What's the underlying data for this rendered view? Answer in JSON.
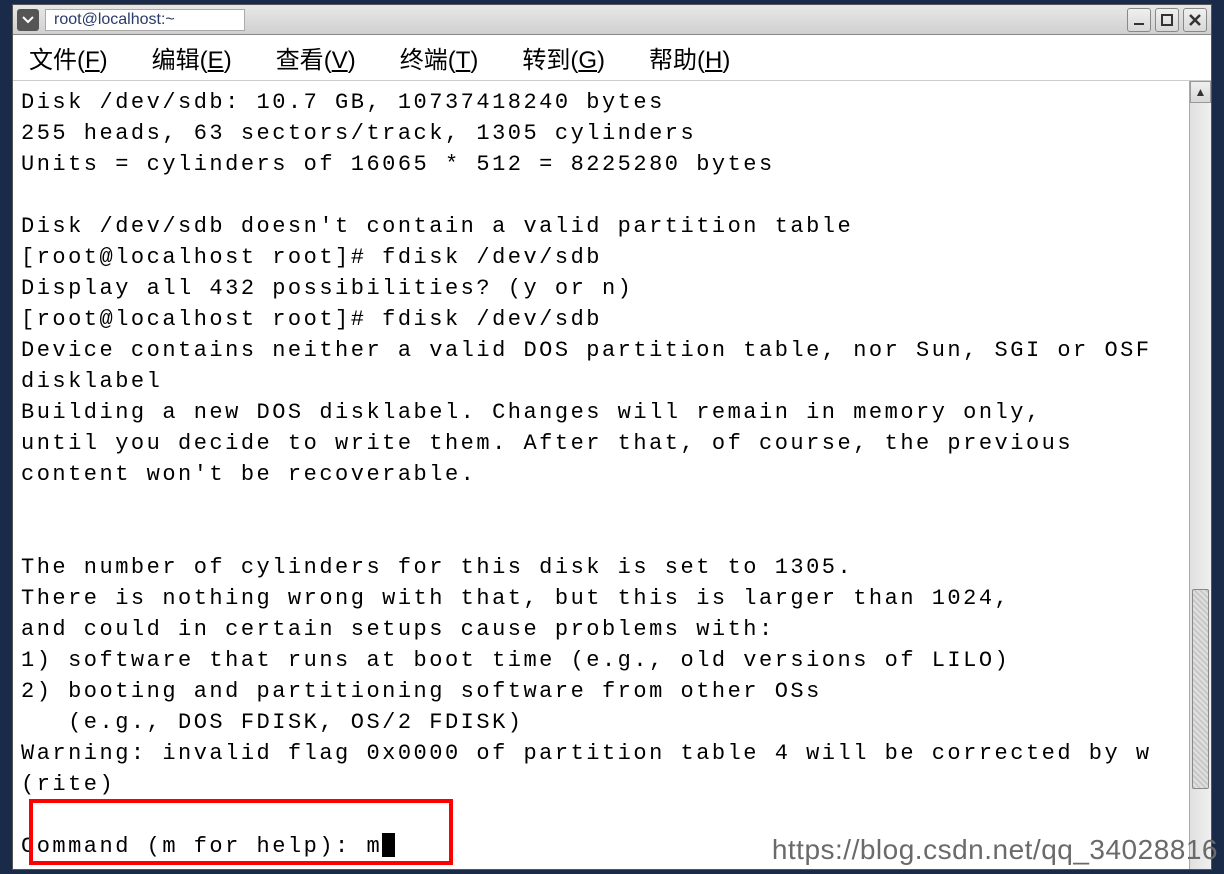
{
  "titlebar": {
    "title": "root@localhost:~"
  },
  "menubar": {
    "items": [
      {
        "label": "文件",
        "accel": "F"
      },
      {
        "label": "编辑",
        "accel": "E"
      },
      {
        "label": "查看",
        "accel": "V"
      },
      {
        "label": "终端",
        "accel": "T"
      },
      {
        "label": "转到",
        "accel": "G"
      },
      {
        "label": "帮助",
        "accel": "H"
      }
    ]
  },
  "terminal": {
    "lines": [
      "Disk /dev/sdb: 10.7 GB, 10737418240 bytes",
      "255 heads, 63 sectors/track, 1305 cylinders",
      "Units = cylinders of 16065 * 512 = 8225280 bytes",
      "",
      "Disk /dev/sdb doesn't contain a valid partition table",
      "[root@localhost root]# fdisk /dev/sdb",
      "Display all 432 possibilities? (y or n)",
      "[root@localhost root]# fdisk /dev/sdb",
      "Device contains neither a valid DOS partition table, nor Sun, SGI or OSF disklabel",
      "Building a new DOS disklabel. Changes will remain in memory only,",
      "until you decide to write them. After that, of course, the previous",
      "content won't be recoverable.",
      "",
      "",
      "The number of cylinders for this disk is set to 1305.",
      "There is nothing wrong with that, but this is larger than 1024,",
      "and could in certain setups cause problems with:",
      "1) software that runs at boot time (e.g., old versions of LILO)",
      "2) booting and partitioning software from other OSs",
      "   (e.g., DOS FDISK, OS/2 FDISK)",
      "Warning: invalid flag 0x0000 of partition table 4 will be corrected by w(rite)",
      ""
    ],
    "prompt": "Command (m for help): ",
    "input": "m"
  },
  "watermark": "https://blog.csdn.net/qq_34028816"
}
